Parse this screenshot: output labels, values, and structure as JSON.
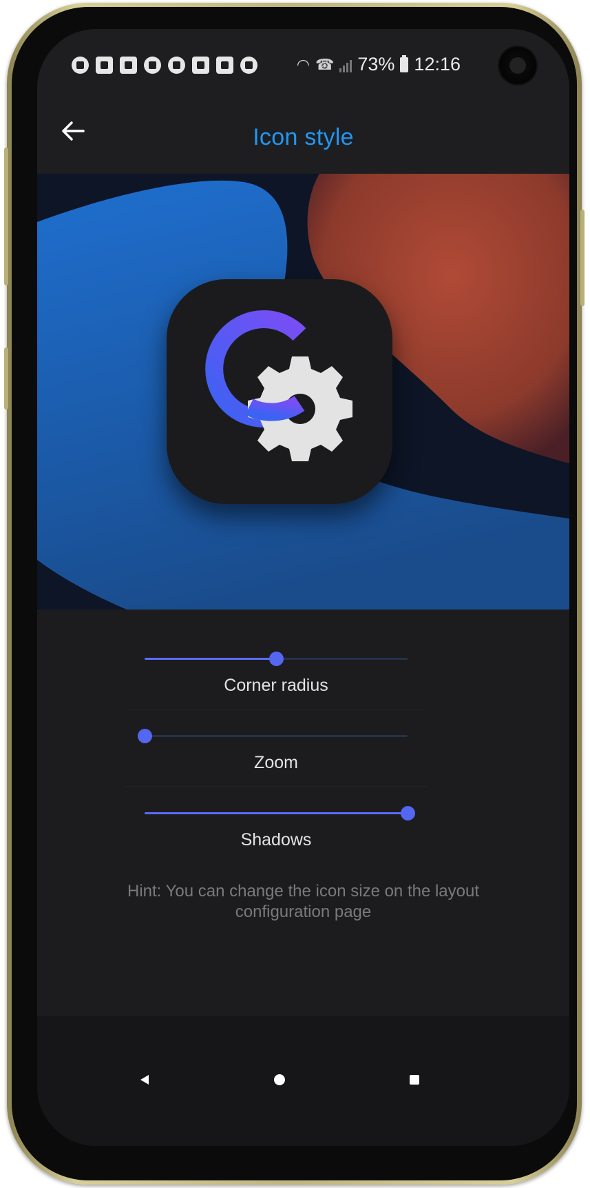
{
  "app_bar": {
    "title": "Icon style",
    "back_icon": "arrow-left-icon"
  },
  "status_bar": {
    "notification_icons": [
      "spotify-icon",
      "message-icon",
      "instagram-icon",
      "snapchat-icon",
      "messenger-icon",
      "gallery-icon",
      "speaker-icon",
      "tile-icon"
    ],
    "battery": "73%",
    "time": "12:16"
  },
  "preview": {
    "app_icon": "settings-gear-c-logo-icon"
  },
  "sliders": [
    {
      "label": "Corner radius",
      "value": 0.5
    },
    {
      "label": "Zoom",
      "value": 0.0
    },
    {
      "label": "Shadows",
      "value": 1.0
    }
  ],
  "hint": "Hint: You can change the icon size on the layout configuration page",
  "nav": {
    "back_icon": "triangle-back-icon",
    "home_icon": "circle-home-icon",
    "recents_icon": "square-recents-icon"
  },
  "colors": {
    "accent": "#2196f3",
    "slider": "#5566f0",
    "background": "#1c1c1e"
  }
}
